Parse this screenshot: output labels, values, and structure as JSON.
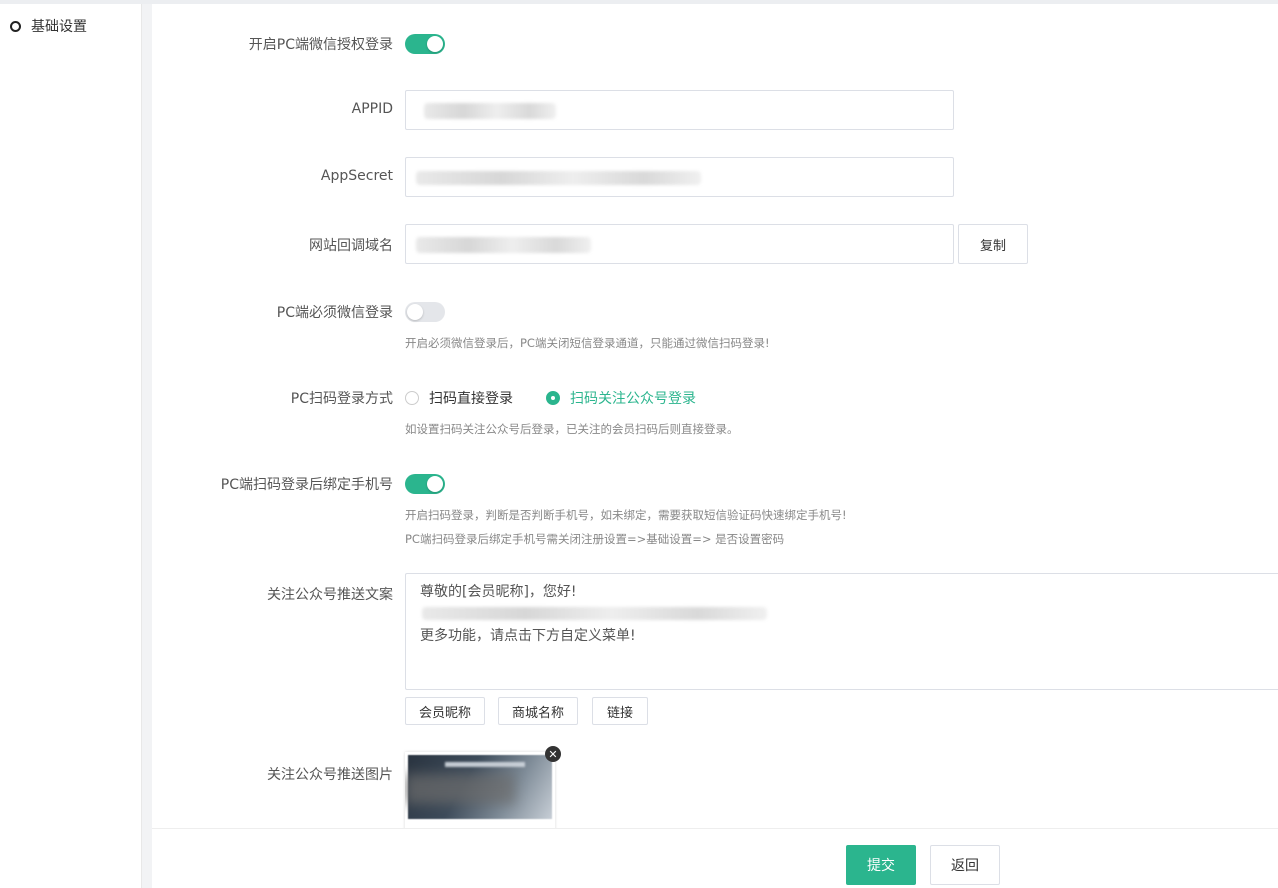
{
  "sidebar": {
    "items": [
      {
        "label": "基础设置"
      }
    ]
  },
  "form": {
    "pc_wechat_login": {
      "label": "开启PC端微信授权登录",
      "enabled": true
    },
    "appid": {
      "label": "APPID"
    },
    "appsecret": {
      "label": "AppSecret"
    },
    "callback_domain": {
      "label": "网站回调域名",
      "copy_label": "复制"
    },
    "pc_must_wechat": {
      "label": "PC端必须微信登录",
      "enabled": false,
      "hint": "开启必须微信登录后，PC端关闭短信登录通道，只能通过微信扫码登录!"
    },
    "pc_scan_mode": {
      "label": "PC扫码登录方式",
      "options": [
        "扫码直接登录",
        "扫码关注公众号登录"
      ],
      "selected": "扫码关注公众号登录",
      "hint": "如设置扫码关注公众号后登录，已关注的会员扫码后则直接登录。"
    },
    "bind_phone": {
      "label": "PC端扫码登录后绑定手机号",
      "enabled": true,
      "hint1": "开启扫码登录，判断是否判断手机号，如未绑定，需要获取短信验证码快速绑定手机号!",
      "hint2": "PC端扫码登录后绑定手机号需关闭注册设置=>基础设置=> 是否设置密码"
    },
    "push_text": {
      "label": "关注公众号推送文案",
      "line1": "尊敬的[会员昵称]，您好!",
      "line3": "更多功能，请点击下方自定义菜单!",
      "tags": [
        "会员昵称",
        "商城名称",
        "链接"
      ]
    },
    "push_image": {
      "label": "关注公众号推送图片",
      "close_icon": "✕"
    }
  },
  "footer": {
    "submit_label": "提交",
    "back_label": "返回"
  },
  "colors": {
    "accent": "#2bb58e"
  }
}
